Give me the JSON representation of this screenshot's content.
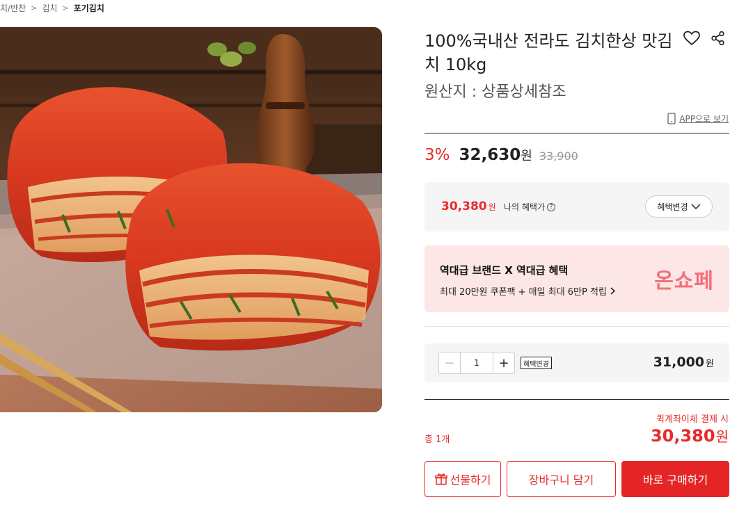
{
  "breadcrumb": {
    "items": [
      "치/반찬",
      "김치",
      "포기김치"
    ]
  },
  "product": {
    "title": "100%국내산 전라도 김치한상 맛김치 10kg",
    "origin": "원산지 : 상품상세참조",
    "image_alt": "포기김치"
  },
  "icons": {
    "heart": "heart-icon",
    "share": "share-icon",
    "phone": "phone-icon",
    "gift": "gift-icon"
  },
  "app_view": {
    "label": "APP으로 보기"
  },
  "price": {
    "discount": "3%",
    "sale": "32,630",
    "won": "원",
    "original": "33,900"
  },
  "benefit": {
    "price": "30,380",
    "won": "원",
    "label": "나의 혜택가",
    "help": "?",
    "change_button": "혜택변경"
  },
  "promo": {
    "title": "역대급 브랜드 X 역대급 혜택",
    "subtitle": "최대 20만원 쿠폰팩 + 매일 최대 6만P 적립",
    "logo": "온쇼페"
  },
  "option": {
    "quantity": "1",
    "minus": "−",
    "plus": "+",
    "benefit_tag": "혜택변경",
    "price": "31,000",
    "won": "원"
  },
  "total": {
    "quick_pay": "퀵계좌이체 결제 시",
    "qty": "총 1개",
    "price": "30,380",
    "won": "원"
  },
  "actions": {
    "gift": "선물하기",
    "cart": "장바구니 담기",
    "buy": "바로 구매하기"
  },
  "colors": {
    "accent": "#e72a2a",
    "promo_bg": "#fde6e6",
    "promo_logo": "#f2717b",
    "panel_bg": "#f5f5f6"
  }
}
